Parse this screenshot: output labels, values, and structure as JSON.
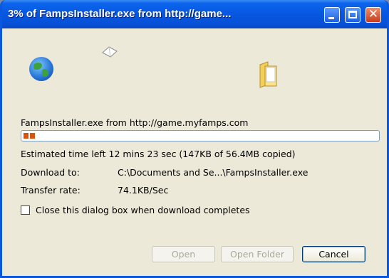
{
  "window": {
    "title": "3% of FampsInstaller.exe from http://game..."
  },
  "titlebar_buttons": {
    "close_glyph": "✕"
  },
  "icons": {
    "source": "globe-icon",
    "animation": "flying-paper-icon",
    "target": "folder-icon"
  },
  "download": {
    "source_label": "FampsInstaller.exe from http://game.myfamps.com",
    "progress_percent": 3,
    "estimated_time": "Estimated time left 12 mins 23 sec (147KB of 56.4MB copied)",
    "download_to_label": "Download to:",
    "download_to_value": "C:\\Documents and Se...\\FampsInstaller.exe",
    "transfer_rate_label": "Transfer rate:",
    "transfer_rate_value": "74.1KB/Sec"
  },
  "options": {
    "close_on_complete_label": "Close this dialog box when download completes",
    "close_on_complete_checked": false
  },
  "buttons": {
    "open": "Open",
    "open_folder": "Open Folder",
    "cancel": "Cancel"
  },
  "colors": {
    "titlebar": "#0b58e0",
    "progress_fill": "#d9530d",
    "dialog_bg": "#ece9d8"
  }
}
